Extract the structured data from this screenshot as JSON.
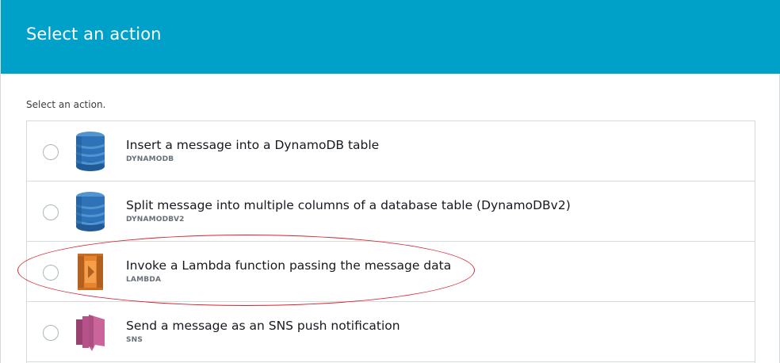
{
  "dialog": {
    "title": "Select an action",
    "subtitle": "Select an action."
  },
  "actions": [
    {
      "title": "Insert a message into a DynamoDB table",
      "code": "DYNAMODB",
      "icon": "dynamodb-icon",
      "color": "#2e73b8",
      "selected": false
    },
    {
      "title": "Split message into multiple columns of a database table (DynamoDBv2)",
      "code": "DYNAMODBV2",
      "icon": "dynamodb-icon",
      "color": "#2e73b8",
      "selected": false
    },
    {
      "title": "Invoke a Lambda function passing the message data",
      "code": "LAMBDA",
      "icon": "lambda-icon",
      "color": "#e7822f",
      "selected": false,
      "highlighted": true
    },
    {
      "title": "Send a message as an SNS push notification",
      "code": "SNS",
      "icon": "sns-icon",
      "color": "#c9659b",
      "selected": false
    }
  ],
  "colors": {
    "header_bg": "#00a1c9",
    "annotation": "#d9232e"
  }
}
